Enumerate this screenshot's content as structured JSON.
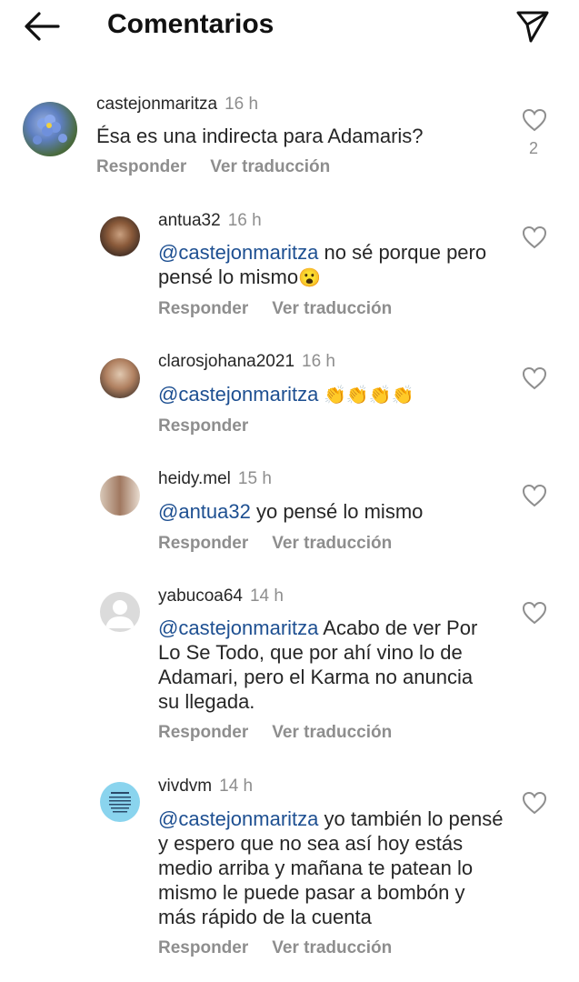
{
  "header": {
    "title": "Comentarios"
  },
  "comments": [
    {
      "username": "castejonmaritza",
      "time": "16 h",
      "mention": "",
      "text": "Ésa es una indirecta para Adamaris?",
      "emoji": "",
      "reply_label": "Responder",
      "translate_label": "Ver traducción",
      "likes": "2"
    },
    {
      "username": "antua32",
      "time": "16 h",
      "mention": "@castejonmaritza",
      "text": " no sé porque pero pensé lo mismo",
      "emoji": "😮",
      "reply_label": "Responder",
      "translate_label": "Ver traducción"
    },
    {
      "username": "clarosjohana2021",
      "time": "16 h",
      "mention": "@castejonmaritza",
      "text": "",
      "emoji": " 👏👏👏👏",
      "reply_label": "Responder",
      "translate_label": ""
    },
    {
      "username": "heidy.mel",
      "time": "15 h",
      "mention": "@antua32",
      "text": " yo pensé lo mismo",
      "emoji": "",
      "reply_label": "Responder",
      "translate_label": "Ver traducción"
    },
    {
      "username": "yabucoa64",
      "time": "14 h",
      "mention": "@castejonmaritza",
      "text": " Acabo de ver Por Lo Se Todo, que por ahí vino lo de Adamari, pero el Karma no anuncia su llegada.",
      "emoji": "",
      "reply_label": "Responder",
      "translate_label": "Ver traducción"
    },
    {
      "username": "vivdvm",
      "time": "14 h",
      "mention": "@castejonmaritza",
      "text": " yo también lo pensé y espero que no sea así hoy estás medio arriba y mañana te patean lo mismo le puede pasar a bombón y más rápido de la cuenta",
      "emoji": "",
      "reply_label": "Responder",
      "translate_label": "Ver traducción"
    }
  ],
  "icons": {
    "back": "arrow-left-icon",
    "send": "paper-plane-icon",
    "like": "heart-outline-icon"
  },
  "colors": {
    "mention": "#1d4f91",
    "secondary": "#8e8e8e",
    "text": "#262626"
  }
}
